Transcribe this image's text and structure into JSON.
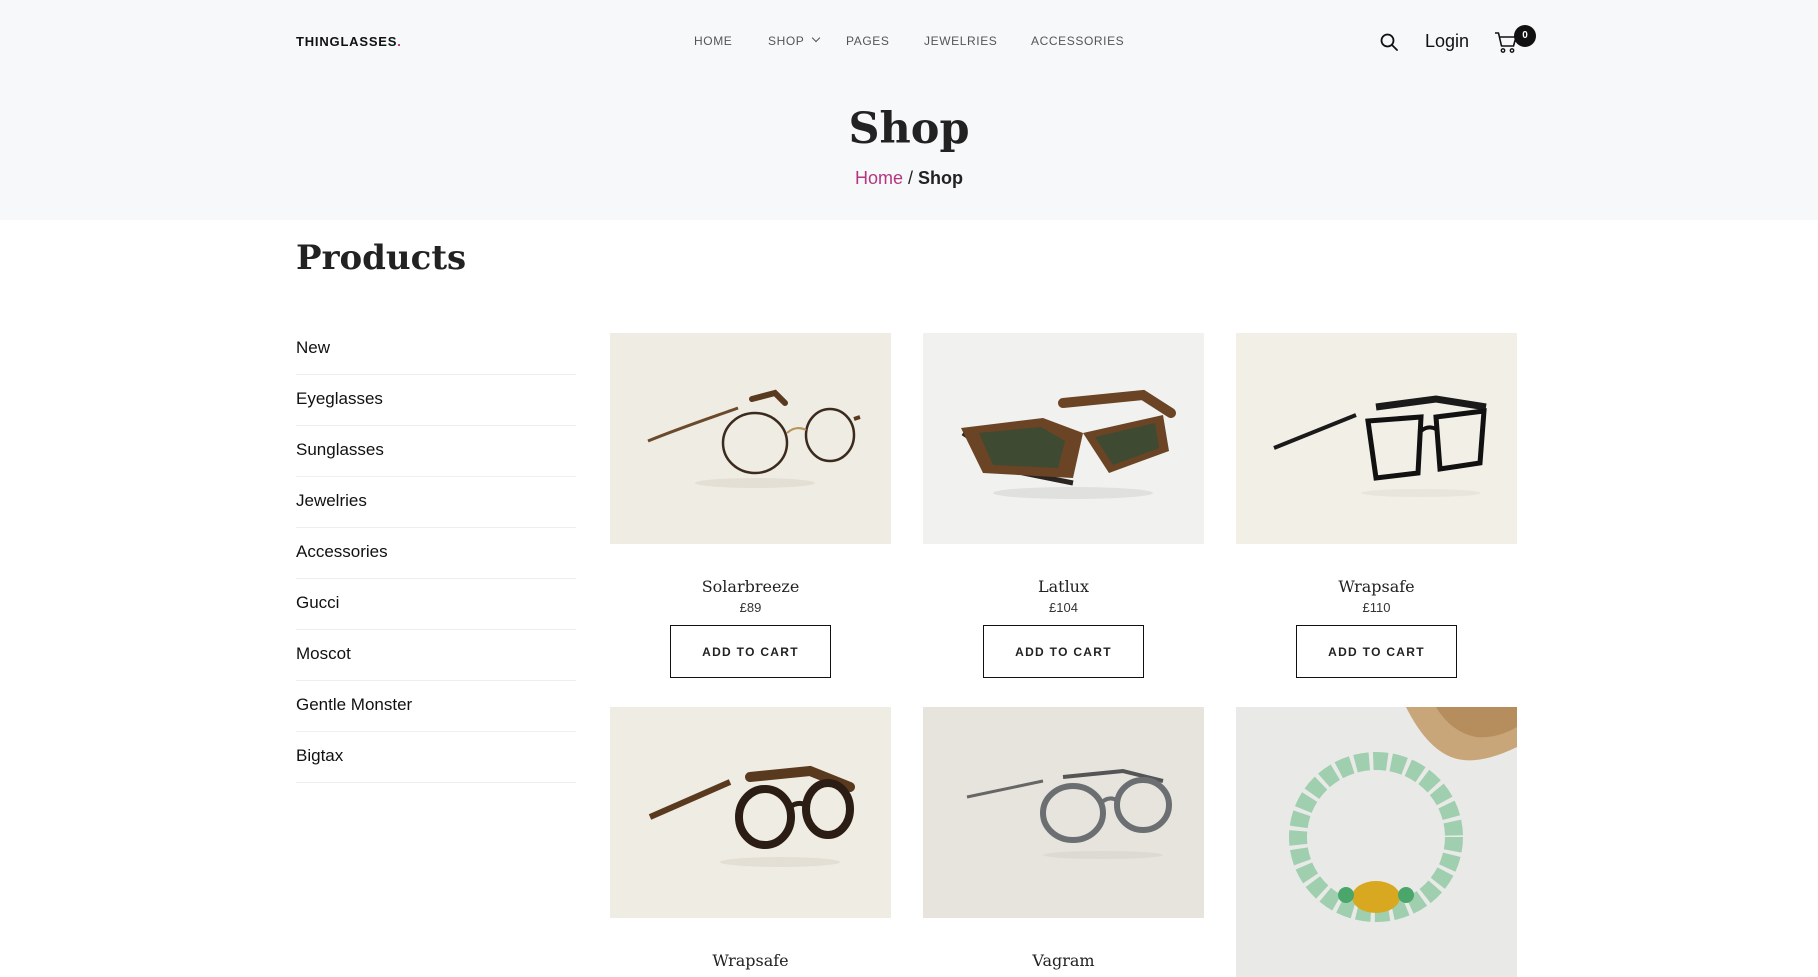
{
  "header": {
    "logo": "THINGLASSES",
    "logo_dot": ".",
    "nav": [
      "HOME",
      "SHOP",
      "PAGES",
      "JEWELRIES",
      "ACCESSORIES"
    ],
    "login": "Login",
    "cart_count": "0",
    "search_icon": "search-icon",
    "cart_icon": "cart-icon"
  },
  "hero": {
    "title": "Shop",
    "breadcrumb_home": "Home",
    "breadcrumb_sep": " / ",
    "breadcrumb_current": "Shop"
  },
  "section_title": "Products",
  "categories": [
    "New",
    "Eyeglasses",
    "Sunglasses",
    "Jewelries",
    "Accessories",
    "Gucci",
    "Moscot",
    "Gentle Monster",
    "Bigtax"
  ],
  "products": [
    {
      "name": "Solarbreeze",
      "price": "£89",
      "button": "ADD TO CART"
    },
    {
      "name": "Latlux",
      "price": "£104",
      "button": "ADD TO CART"
    },
    {
      "name": "Wrapsafe",
      "price": "£110",
      "button": "ADD TO CART"
    },
    {
      "name": "Wrapsafe"
    },
    {
      "name": "Vagram"
    },
    {}
  ],
  "colors": {
    "accent": "#b4367f",
    "header_bg": "#f7f8fa"
  }
}
